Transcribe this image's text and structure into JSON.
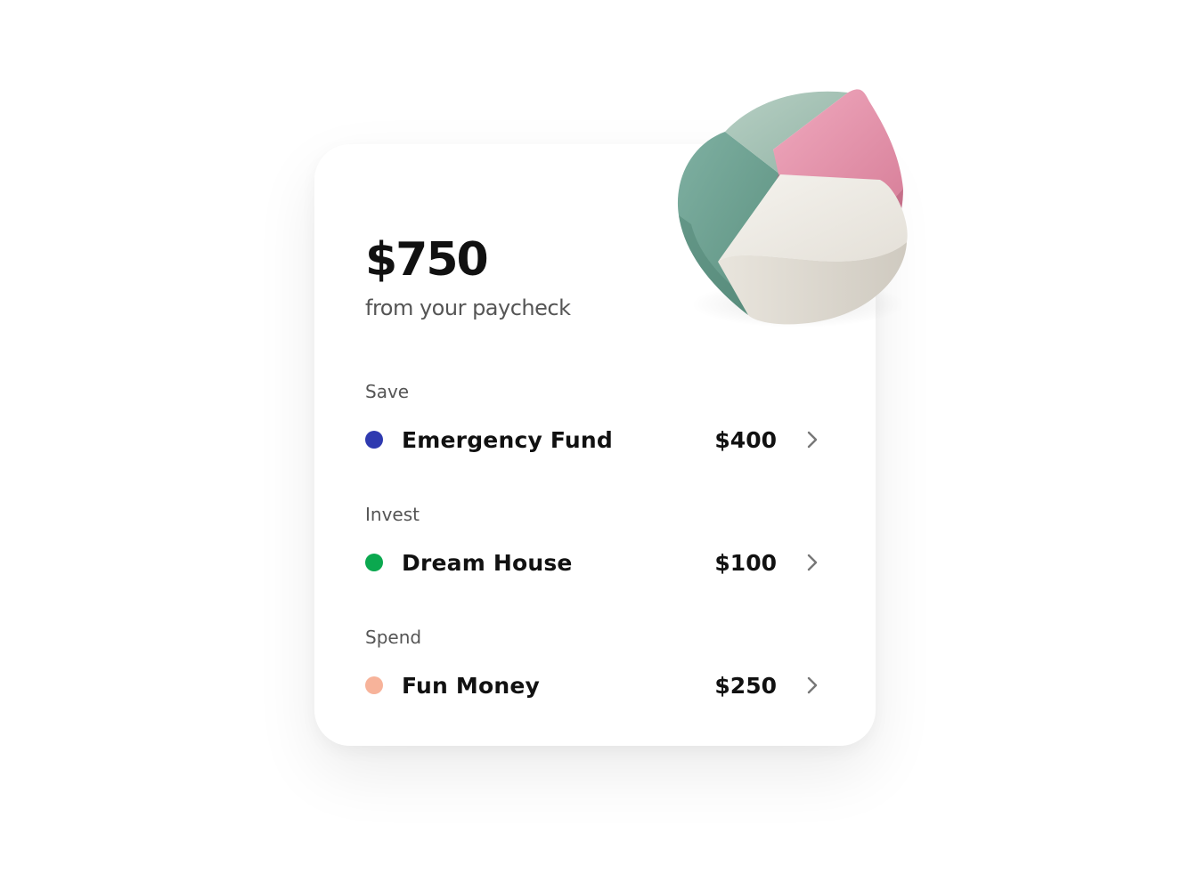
{
  "header": {
    "amount": "$750",
    "subtitle": "from your paycheck"
  },
  "sections": [
    {
      "label": "Save",
      "item": {
        "name": "Emergency Fund",
        "value": "$400",
        "dot_color": "#2f3ab0",
        "icon": "chevron-right-icon"
      }
    },
    {
      "label": "Invest",
      "item": {
        "name": "Dream House",
        "value": "$100",
        "dot_color": "#0ba84f",
        "icon": "chevron-right-icon"
      }
    },
    {
      "label": "Spend",
      "item": {
        "name": "Fun Money",
        "value": "$250",
        "dot_color": "#f7b39a",
        "icon": "chevron-right-icon"
      }
    }
  ],
  "illustration": {
    "icon": "pie-chart-3d-icon",
    "colors": {
      "dark_green": "#6fa595",
      "light_green": "#a8c4b7",
      "pink": "#e899b0",
      "cream": "#e9e6df"
    }
  }
}
